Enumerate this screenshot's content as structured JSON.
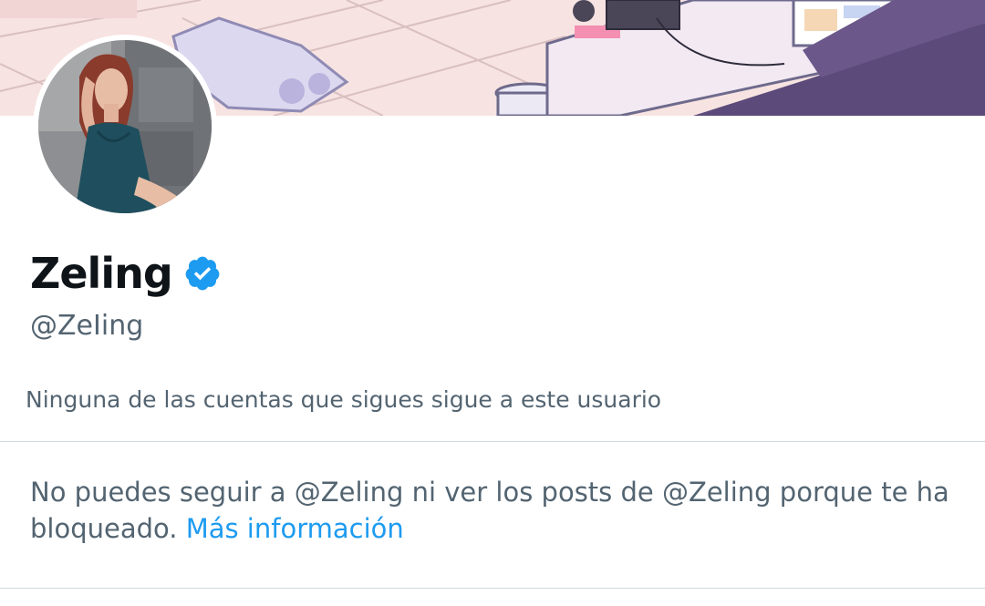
{
  "profile": {
    "display_name": "Zeling",
    "handle": "@ZeIing",
    "verified": true,
    "followers_you_know": "Ninguna de las cuentas que sigues sigue a este usuario"
  },
  "blocked_notice": {
    "text": "No puedes seguir a @Zeling ni ver los posts de @Zeling porque te ha bloqueado.",
    "link_label": "Más información"
  },
  "colors": {
    "accent": "#1d9bf0",
    "secondary_text": "#536471",
    "primary_text": "#0f1419",
    "divider": "#cfd9de"
  },
  "icons": {
    "verified": "verified-badge-icon"
  }
}
